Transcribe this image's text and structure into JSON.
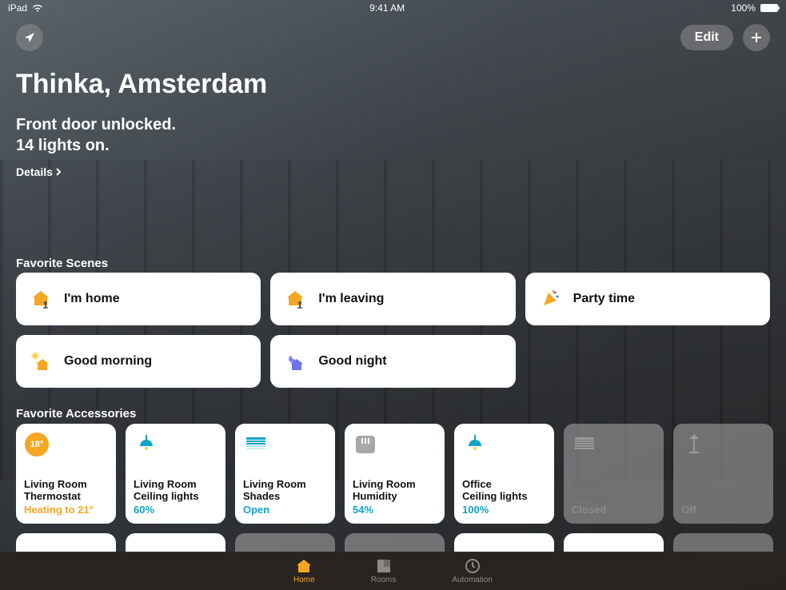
{
  "statusbar": {
    "device": "iPad",
    "time": "9:41 AM",
    "battery_pct": "100%"
  },
  "header": {
    "edit_label": "Edit",
    "home_name": "Thinka, Amsterdam",
    "status_line1": "Front door unlocked.",
    "status_line2": "14 lights on.",
    "details_label": "Details"
  },
  "sections": {
    "scenes_label": "Favorite Scenes",
    "accessories_label": "Favorite Accessories"
  },
  "scenes": [
    {
      "label": "I'm home",
      "icon": "house-person"
    },
    {
      "label": "I'm leaving",
      "icon": "house-person"
    },
    {
      "label": "Party time",
      "icon": "party"
    },
    {
      "label": "Good morning",
      "icon": "house-sun"
    },
    {
      "label": "Good night",
      "icon": "house-moon"
    }
  ],
  "accessories": [
    {
      "name_line1": "Living Room",
      "name_line2": "Thermostat",
      "status": "Heating to 21°",
      "status_color": "orange",
      "state": "on",
      "icon": "thermostat",
      "badge": "18°"
    },
    {
      "name_line1": "Living Room",
      "name_line2": "Ceiling lights",
      "status": "60%",
      "state": "on",
      "icon": "ceiling-light"
    },
    {
      "name_line1": "Living Room",
      "name_line2": "Shades",
      "status": "Open",
      "state": "on",
      "icon": "shades"
    },
    {
      "name_line1": "Living Room",
      "name_line2": "Humidity",
      "status": "54%",
      "state": "on",
      "icon": "humidity"
    },
    {
      "name_line1": "Office",
      "name_line2": "Ceiling lights",
      "status": "100%",
      "state": "on",
      "icon": "ceiling-light"
    },
    {
      "name_line1": "Office",
      "name_line2": "Shades",
      "status": "Closed",
      "state": "off",
      "icon": "shades"
    },
    {
      "name_line1": "Office",
      "name_line2": "Floor lamp",
      "status": "Off",
      "state": "off",
      "icon": "floor-lamp"
    }
  ],
  "tabs": [
    {
      "label": "Home",
      "active": true
    },
    {
      "label": "Rooms",
      "active": false
    },
    {
      "label": "Automation",
      "active": false
    }
  ]
}
